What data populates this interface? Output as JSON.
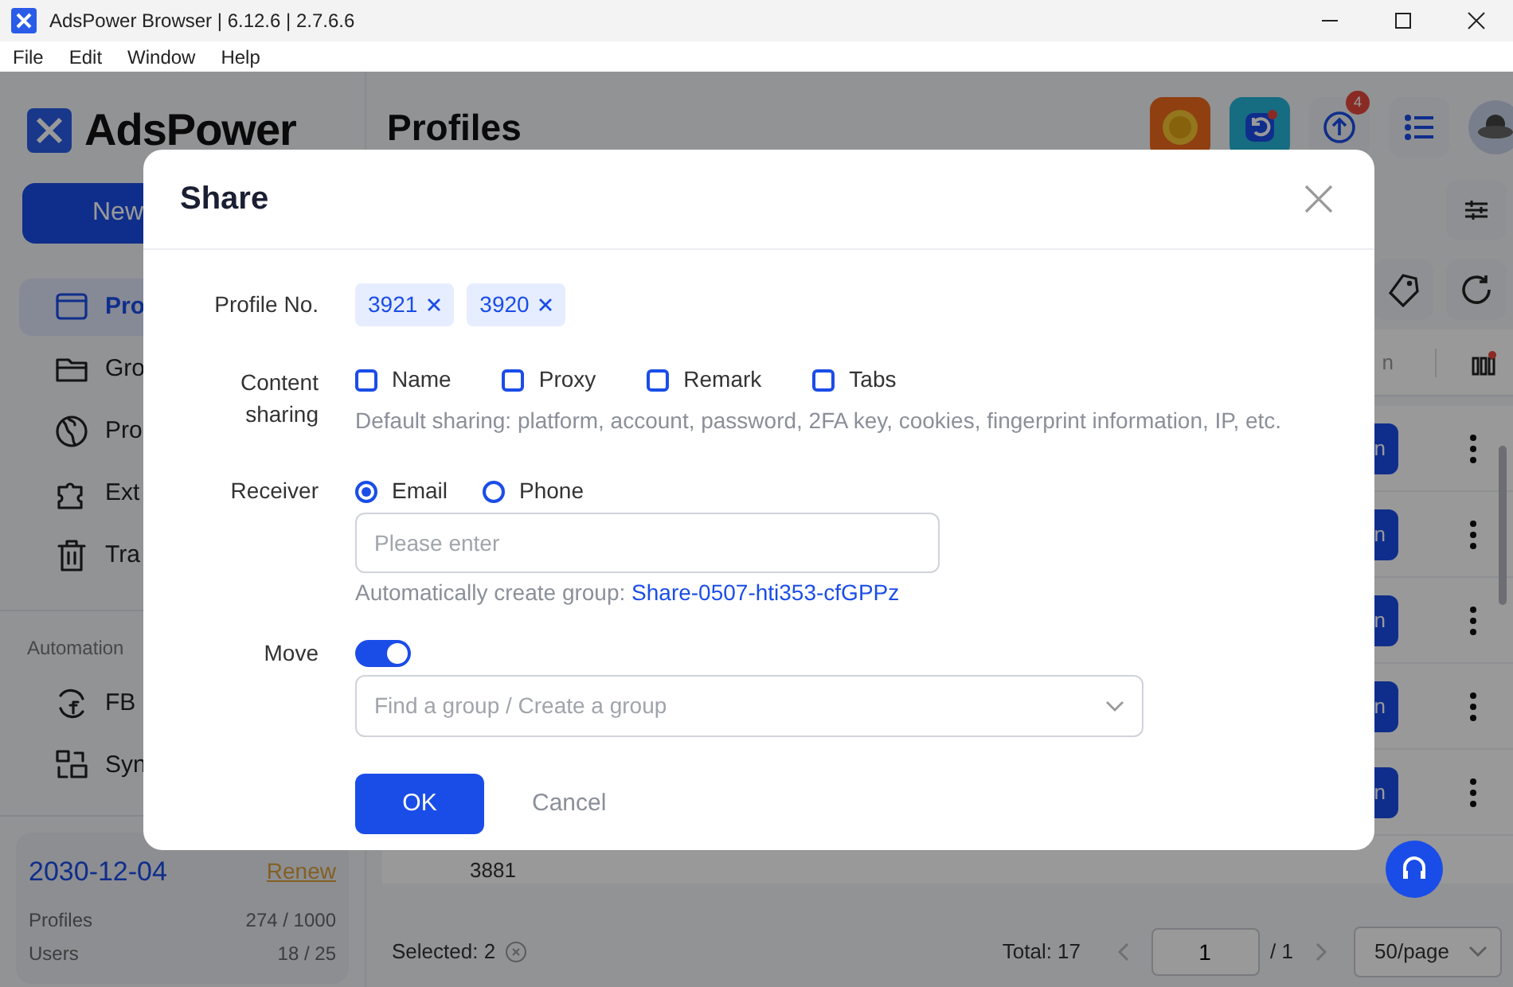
{
  "window": {
    "title": "AdsPower Browser | 6.12.6 | 2.7.6.6"
  },
  "menu": [
    "File",
    "Edit",
    "Window",
    "Help"
  ],
  "sidebar": {
    "logo": "AdsPower",
    "new_button": "New",
    "items": [
      {
        "label": "Pro",
        "kind": "window",
        "selected": true
      },
      {
        "label": "Gro",
        "kind": "folder",
        "selected": false
      },
      {
        "label": "Pro",
        "kind": "globe",
        "selected": false
      },
      {
        "label": "Ext",
        "kind": "puzzle",
        "selected": false
      },
      {
        "label": "Tra",
        "kind": "trash",
        "selected": false
      }
    ],
    "section": "Automation",
    "automation_items": [
      {
        "label": "FB",
        "kind": "facebook"
      },
      {
        "label": "Syn",
        "kind": "sync"
      }
    ],
    "plan": {
      "expiry": "2030-12-04",
      "renew": "Renew",
      "stats": [
        {
          "label": "Profiles",
          "value": "274 / 1000"
        },
        {
          "label": "Users",
          "value": "18 / 25"
        }
      ]
    }
  },
  "main": {
    "title": "Profiles",
    "notification_count": "4",
    "column_fragment": "n",
    "rows": [
      {
        "button": "n"
      },
      {
        "button": "n"
      },
      {
        "button": "n"
      },
      {
        "button": "n"
      },
      {
        "button": "n"
      }
    ],
    "partial_row": {
      "number": "3881"
    }
  },
  "footer": {
    "selected": "Selected: 2",
    "total": "Total: 17",
    "page": "1",
    "page_count": "/ 1",
    "page_size": "50/page"
  },
  "dialog": {
    "title": "Share",
    "profile_no": {
      "label": "Profile No.",
      "tags": [
        "3921",
        "3920"
      ]
    },
    "content_sharing": {
      "label": "Content sharing",
      "options": [
        {
          "label": "Name",
          "checked": false
        },
        {
          "label": "Proxy",
          "checked": false
        },
        {
          "label": "Remark",
          "checked": false
        },
        {
          "label": "Tabs",
          "checked": false
        }
      ],
      "hint": "Default sharing: platform, account, password, 2FA key, cookies, fingerprint information, IP, etc."
    },
    "receiver": {
      "label": "Receiver",
      "options": [
        {
          "label": "Email",
          "selected": true
        },
        {
          "label": "Phone",
          "selected": false
        }
      ],
      "placeholder": "Please enter",
      "group_note": "Automatically create group:",
      "group_name": "Share-0507-hti353-cfGPPz"
    },
    "move": {
      "label": "Move",
      "on": true,
      "placeholder": "Find a group / Create a group"
    },
    "ok": "OK",
    "cancel": "Cancel"
  }
}
